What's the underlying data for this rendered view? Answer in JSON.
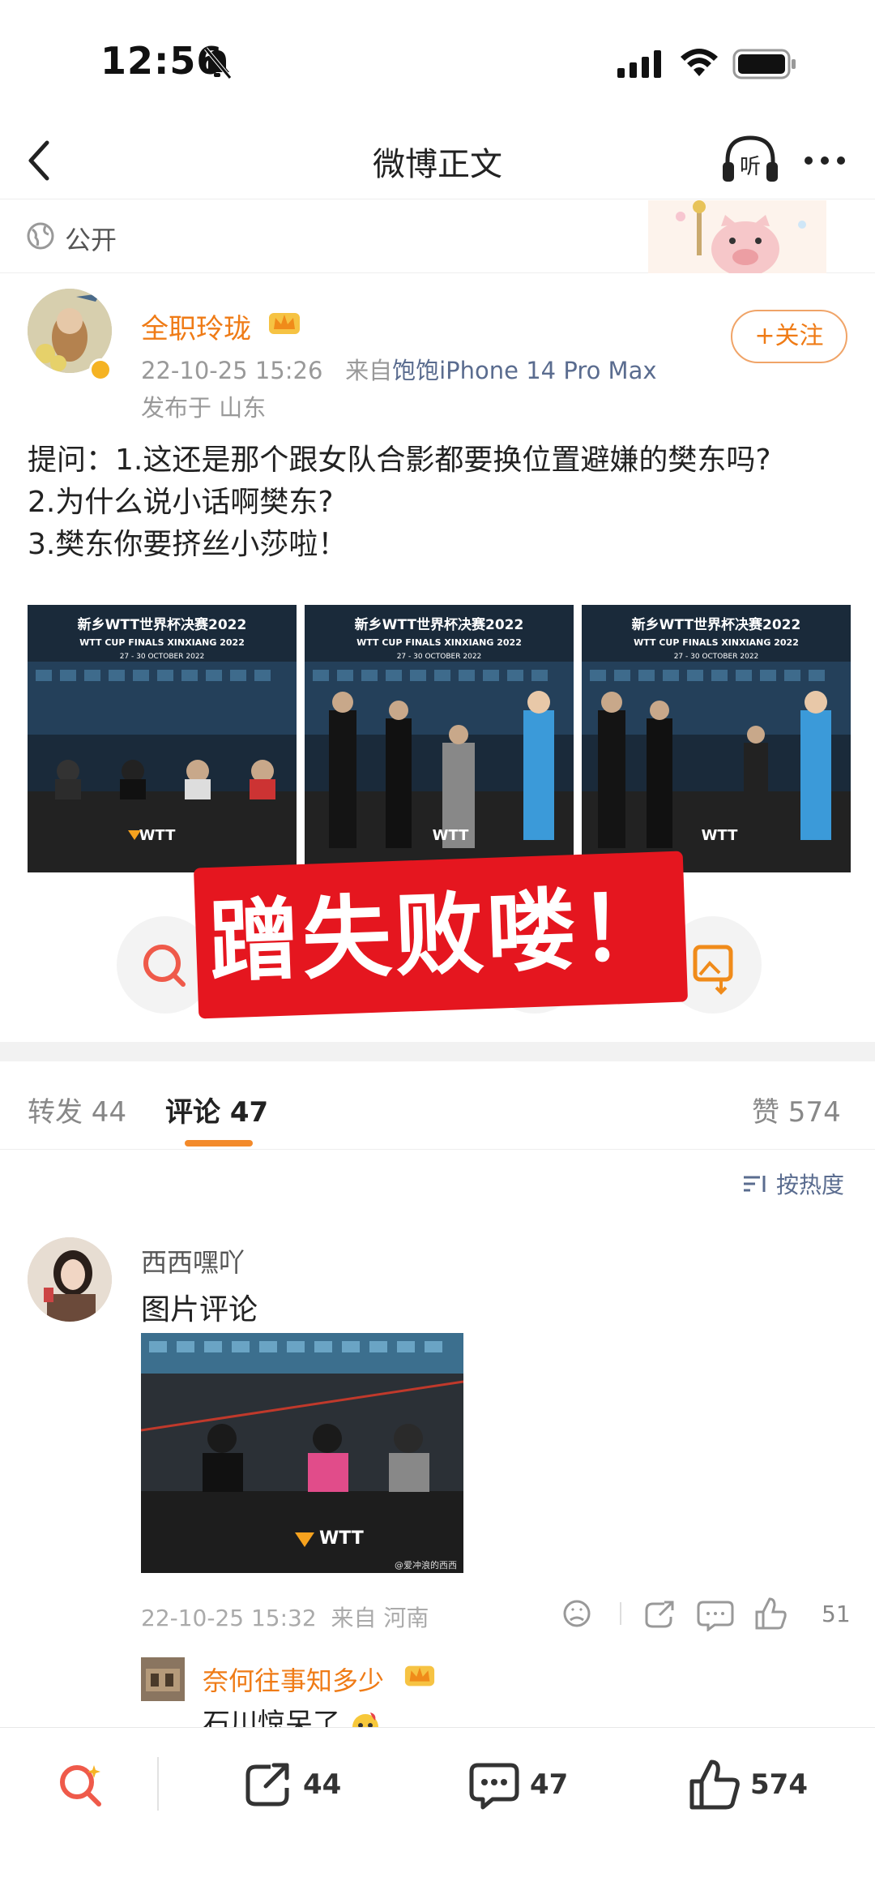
{
  "status_bar": {
    "time": "12:56"
  },
  "nav": {
    "title": "微博正文",
    "listen_label": "听"
  },
  "visibility": {
    "label": "公开"
  },
  "post": {
    "username": "全职玲珑",
    "timestamp": "22-10-25 15:26",
    "source_prefix": "来自",
    "device": "饱饱iPhone 14 Pro Max",
    "location": "发布于 山东",
    "follow_label": "+关注",
    "text_lines": [
      "提问：1.这还是那个跟女队合影都要换位置避嫌的樊东吗?",
      "2.为什么说小话啊樊东?",
      "3.樊东你要挤丝小莎啦！"
    ],
    "image_banner_cn": "新乡WTT世界杯决赛2022",
    "image_banner_en": "WTT CUP FINALS XINXIANG 2022",
    "image_dates": "27 - 30 OCTOBER 2022",
    "sticker_text": "蹭失败喽！"
  },
  "tabs": {
    "repost": "转发 44",
    "comment": "评论 47",
    "like": "赞 574"
  },
  "sort_label": "按热度",
  "comment": {
    "username": "西西嘿吖",
    "text": "图片评论",
    "timestamp": "22-10-25 15:32",
    "source": "来自 河南",
    "like_count": "51",
    "image_watermark": "@爱冲浪的西西",
    "image_logo": "WTT"
  },
  "reply": {
    "username": "奈何往事知多少",
    "text": "石川惊呆了"
  },
  "bottom_bar": {
    "repost_count": "44",
    "comment_count": "47",
    "like_count": "574"
  },
  "colors": {
    "accent_orange": "#ef7b16",
    "link_blue": "#5a6c8f",
    "sticker_red": "#e5161f"
  }
}
